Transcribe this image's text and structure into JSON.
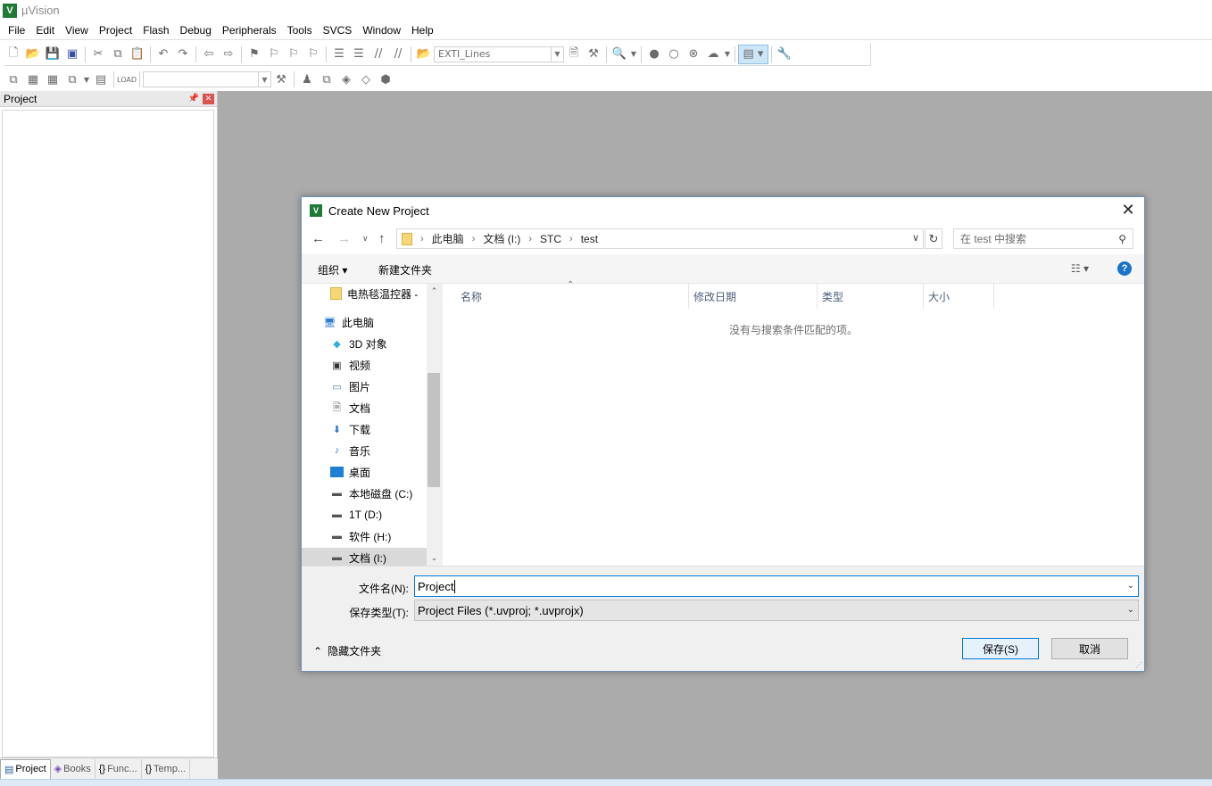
{
  "app": {
    "title": "µVision",
    "logo": "V"
  },
  "menu": [
    "File",
    "Edit",
    "View",
    "Project",
    "Flash",
    "Debug",
    "Peripherals",
    "Tools",
    "SVCS",
    "Window",
    "Help"
  ],
  "toolbar": {
    "target_combo": "EXTI_Lines",
    "secondary_combo": ""
  },
  "project_panel": {
    "title": "Project",
    "tabs": [
      {
        "label": "Project",
        "icon": "project-icon"
      },
      {
        "label": "Books",
        "icon": "books-icon"
      },
      {
        "label": "Func...",
        "icon": "functions-icon"
      },
      {
        "label": "Temp...",
        "icon": "templates-icon"
      }
    ]
  },
  "dialog": {
    "title": "Create New Project",
    "breadcrumb": [
      "此电脑",
      "文档 (I:)",
      "STC",
      "test"
    ],
    "search_placeholder": "在 test 中搜索",
    "organize": "组织",
    "new_folder": "新建文件夹",
    "nav_items": [
      {
        "label": "电热毯温控器 - ",
        "icon": "folder-icon"
      },
      {
        "label": "此电脑",
        "icon": "computer-icon"
      },
      {
        "label": "3D 对象",
        "icon": "3d-objects-icon"
      },
      {
        "label": "视频",
        "icon": "video-icon"
      },
      {
        "label": "图片",
        "icon": "pictures-icon"
      },
      {
        "label": "文档",
        "icon": "documents-icon"
      },
      {
        "label": "下载",
        "icon": "download-icon"
      },
      {
        "label": "音乐",
        "icon": "music-icon"
      },
      {
        "label": "桌面",
        "icon": "desktop-icon"
      },
      {
        "label": "本地磁盘 (C:)",
        "icon": "system-drive-icon"
      },
      {
        "label": "1T (D:)",
        "icon": "drive-icon"
      },
      {
        "label": "软件 (H:)",
        "icon": "drive-icon"
      },
      {
        "label": "文档 (I:)",
        "icon": "drive-icon",
        "selected": true
      }
    ],
    "columns": [
      "名称",
      "修改日期",
      "类型",
      "大小"
    ],
    "empty_message": "没有与搜索条件匹配的项。",
    "filename_label": "文件名(N):",
    "filename_value": "Project",
    "filetype_label": "保存类型(T):",
    "filetype_value": "Project Files (*.uvproj; *.uvprojx)",
    "hide_folders": "隐藏文件夹",
    "save_button": "保存(S)",
    "cancel_button": "取消"
  }
}
